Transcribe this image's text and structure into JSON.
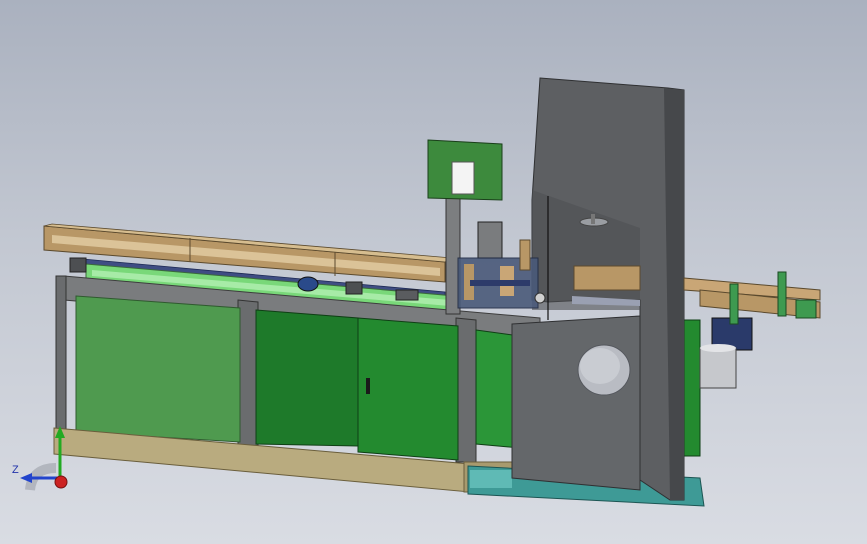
{
  "view": {
    "background_top": "#aab1bf",
    "background_bottom": "#d9dce3"
  },
  "model": {
    "description_icon": "band-saw-machine-3d-model",
    "colors": {
      "frame_gray": "#6f7173",
      "panel_green_light": "#4f9a4f",
      "panel_green_dark": "#1f7a2a",
      "wood_tan": "#b89766",
      "base_khaki": "#b9ab7f",
      "teal_base": "#3e9a96",
      "motor_silver": "#b9bcc3",
      "housing_gray": "#5d5f62"
    }
  },
  "triad": {
    "z_label": "Z",
    "colors": {
      "x": "#2244cc",
      "y": "#22aa22",
      "z": "#cc2222"
    }
  }
}
